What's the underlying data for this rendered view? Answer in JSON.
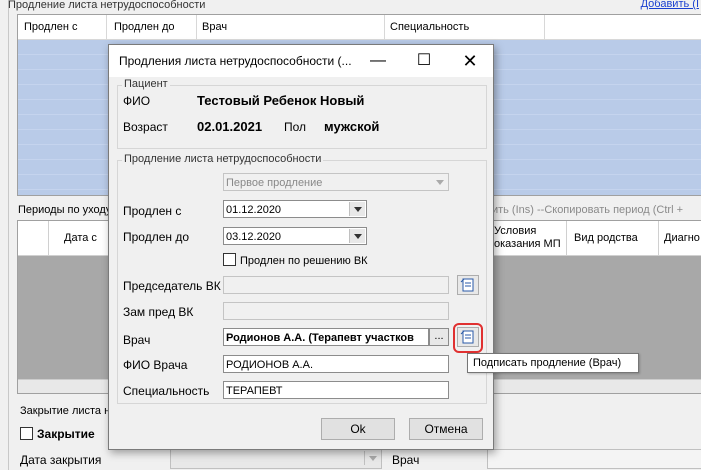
{
  "background": {
    "section1_title": "Продление листа нетрудоспособности",
    "add_link": "Добавить (I",
    "grid1_columns": [
      "Продлен с",
      "Продлен до",
      "Врач",
      "Специальность"
    ],
    "section2_title": "Периоды по уходу",
    "section2_actions": "авить (Ins) --Скопировать период (Ctrl +",
    "grid2_columns": [
      "Дата с",
      "Условия оказания МП",
      "Вид родства",
      "Диагно"
    ],
    "closing_label": "Закрытие листа н",
    "closing_checkbox": "Закрытие",
    "date_close_label": "Дата закрытия",
    "doctor_label": "Врач"
  },
  "dialog": {
    "title": "Продления листа нетрудоспособности (...",
    "patient_group": "Пациент",
    "fio_label": "ФИО",
    "fio_value": "Тестовый Ребенок Новый",
    "age_label": "Возраст",
    "age_value": "02.01.2021",
    "sex_label": "Пол",
    "sex_value": "мужской",
    "extension_group": "Продление листа нетрудоспособности",
    "extension_type": "Первое продление",
    "extended_from_label": "Продлен с",
    "extended_from_value": "01.12.2020",
    "extended_to_label": "Продлен до",
    "extended_to_value": "03.12.2020",
    "vk_checkbox_label": "Продлен по решению ВК",
    "vk_chair_label": "Председатель ВК",
    "vk_deputy_label": "Зам пред ВК",
    "doctor_label": "Врач",
    "doctor_value": "Родионов А.А. (Терапевт участков",
    "ellipsis": "...",
    "doctor_fio_label": "ФИО Врача",
    "doctor_fio_value": "РОДИОНОВ А.А.",
    "specialty_label": "Специальность",
    "specialty_value": "ТЕРАПЕВТ",
    "ok_label": "Ok",
    "cancel_label": "Отмена",
    "tooltip": "Подписать продление (Врач)",
    "highlight_color": "#e03030"
  }
}
